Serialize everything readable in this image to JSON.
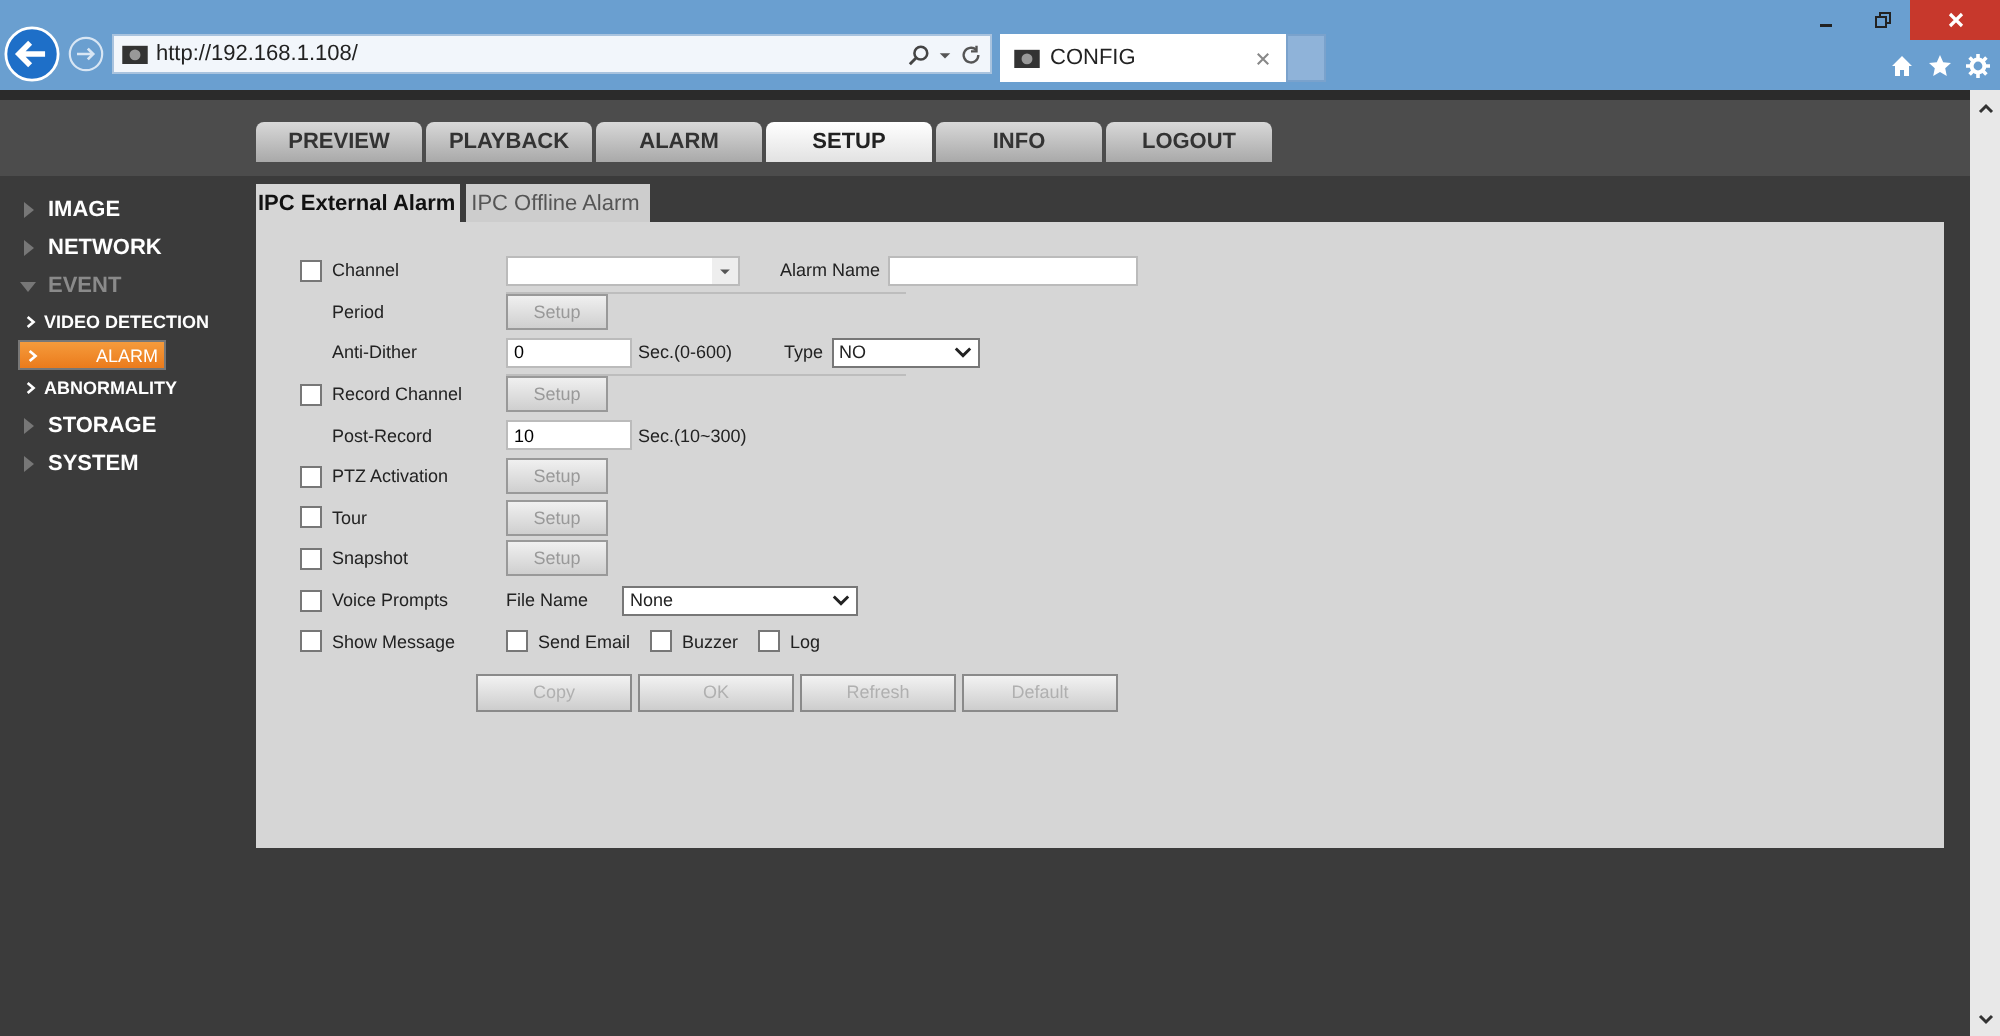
{
  "browser": {
    "address": "http://192.168.1.108/",
    "tab_title": "CONFIG"
  },
  "nav_tabs": [
    {
      "label": "PREVIEW",
      "selected": false
    },
    {
      "label": "PLAYBACK",
      "selected": false
    },
    {
      "label": "ALARM",
      "selected": false
    },
    {
      "label": "SETUP",
      "selected": true
    },
    {
      "label": "INFO",
      "selected": false
    },
    {
      "label": "LOGOUT",
      "selected": false
    }
  ],
  "sidebar": {
    "items": [
      {
        "label": "IMAGE",
        "expanded": false,
        "selected": false
      },
      {
        "label": "NETWORK",
        "expanded": false,
        "selected": false
      },
      {
        "label": "EVENT",
        "expanded": true,
        "selected": false,
        "children": [
          {
            "label": "VIDEO DETECTION",
            "selected": false
          },
          {
            "label": "ALARM",
            "selected": true
          },
          {
            "label": "ABNORMALITY",
            "selected": false
          }
        ]
      },
      {
        "label": "STORAGE",
        "expanded": false,
        "selected": false
      },
      {
        "label": "SYSTEM",
        "expanded": false,
        "selected": false
      }
    ]
  },
  "sub_tabs": [
    {
      "label": "IPC External Alarm",
      "selected": true
    },
    {
      "label": "IPC Offline Alarm",
      "selected": false
    }
  ],
  "form": {
    "rows": [
      {
        "checked": false,
        "label": "Channel",
        "controls": [
          {
            "kind": "combo"
          },
          {
            "kind": "label",
            "text": "Alarm Name"
          },
          {
            "kind": "input",
            "wide": true
          }
        ],
        "divider_after": true
      },
      {
        "label": "Period",
        "controls": [
          {
            "kind": "button",
            "text": "Setup"
          }
        ]
      },
      {
        "label": "Anti-Dither",
        "controls": [
          {
            "kind": "input",
            "value": "0"
          },
          {
            "kind": "text",
            "text": "Sec.(0-600)"
          },
          {
            "kind": "label",
            "text": "Type"
          },
          {
            "kind": "select",
            "value": "NO"
          }
        ],
        "divider_after": true
      },
      {
        "checked": false,
        "label": "Record Channel",
        "controls": [
          {
            "kind": "button",
            "text": "Setup"
          }
        ]
      },
      {
        "label": "Post-Record",
        "controls": [
          {
            "kind": "input",
            "value": "10"
          },
          {
            "kind": "text",
            "text": "Sec.(10~300)"
          }
        ]
      },
      {
        "checked": false,
        "label": "PTZ Activation",
        "controls": [
          {
            "kind": "button",
            "text": "Setup"
          }
        ]
      },
      {
        "checked": false,
        "label": "Tour",
        "controls": [
          {
            "kind": "button",
            "text": "Setup"
          }
        ]
      },
      {
        "checked": false,
        "label": "Snapshot",
        "controls": [
          {
            "kind": "button",
            "text": "Setup"
          }
        ]
      },
      {
        "checked": false,
        "label": "Voice Prompts",
        "controls": [
          {
            "kind": "label",
            "text": "File Name"
          },
          {
            "kind": "select",
            "value": "None",
            "wide": true
          }
        ]
      },
      {
        "checked": false,
        "label": "Show Message",
        "controls": [
          {
            "kind": "check",
            "text": "Send Email",
            "checked": false
          },
          {
            "kind": "check",
            "text": "Buzzer",
            "checked": false
          },
          {
            "kind": "check",
            "text": "Log",
            "checked": false
          }
        ]
      }
    ],
    "buttons": [
      {
        "label": "Copy",
        "disabled": true
      },
      {
        "label": "OK",
        "disabled": true
      },
      {
        "label": "Refresh",
        "disabled": true
      },
      {
        "label": "Default",
        "disabled": true
      }
    ]
  }
}
